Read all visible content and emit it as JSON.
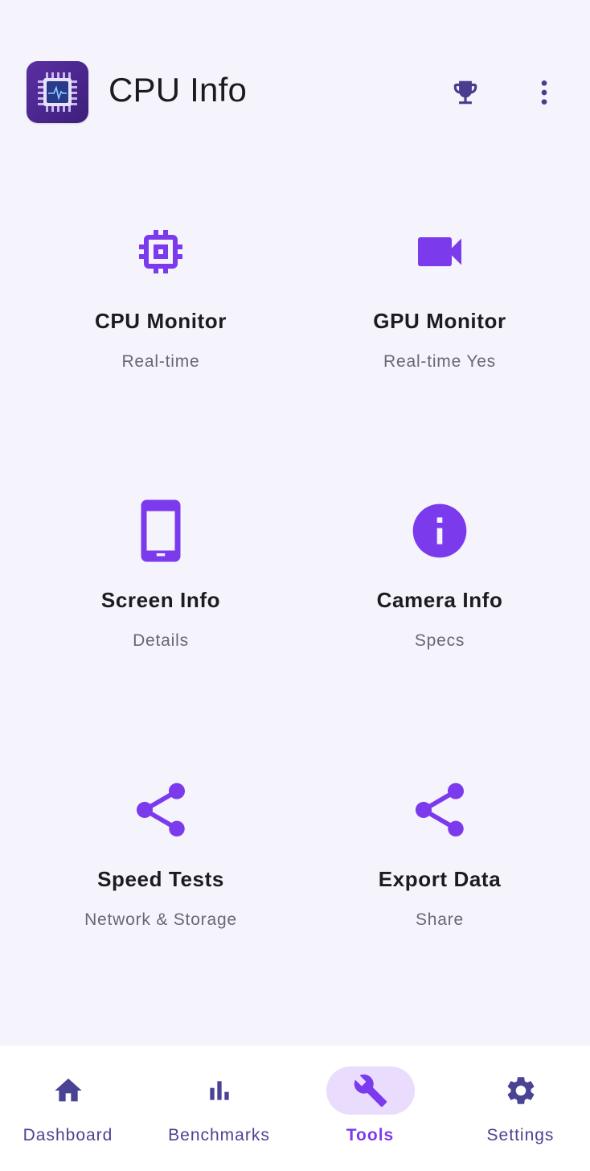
{
  "header": {
    "title": "CPU Info",
    "app_icon": "cpu-chip-app-icon",
    "actions": [
      {
        "name": "trophy-icon"
      },
      {
        "name": "more-vert-icon"
      }
    ]
  },
  "tools": [
    {
      "title": "CPU Monitor",
      "subtitle": "Real-time",
      "icon": "cpu-icon"
    },
    {
      "title": "GPU Monitor",
      "subtitle": "Real-time Yes",
      "icon": "videocam-icon"
    },
    {
      "title": "Screen Info",
      "subtitle": "Details",
      "icon": "smartphone-icon"
    },
    {
      "title": "Camera Info",
      "subtitle": "Specs",
      "icon": "info-icon"
    },
    {
      "title": "Speed Tests",
      "subtitle": "Network & Storage",
      "icon": "share-icon"
    },
    {
      "title": "Export Data",
      "subtitle": "Share",
      "icon": "share-icon"
    }
  ],
  "nav": {
    "items": [
      {
        "label": "Dashboard",
        "icon": "home-icon"
      },
      {
        "label": "Benchmarks",
        "icon": "bar-chart-icon"
      },
      {
        "label": "Tools",
        "icon": "wrench-icon",
        "active": true
      },
      {
        "label": "Settings",
        "icon": "gear-icon"
      }
    ]
  },
  "colors": {
    "accent": "#7c3aed",
    "nav_inactive": "#4a4394",
    "nav_active_pill": "#eadcfc",
    "background": "#f5f3fc"
  }
}
